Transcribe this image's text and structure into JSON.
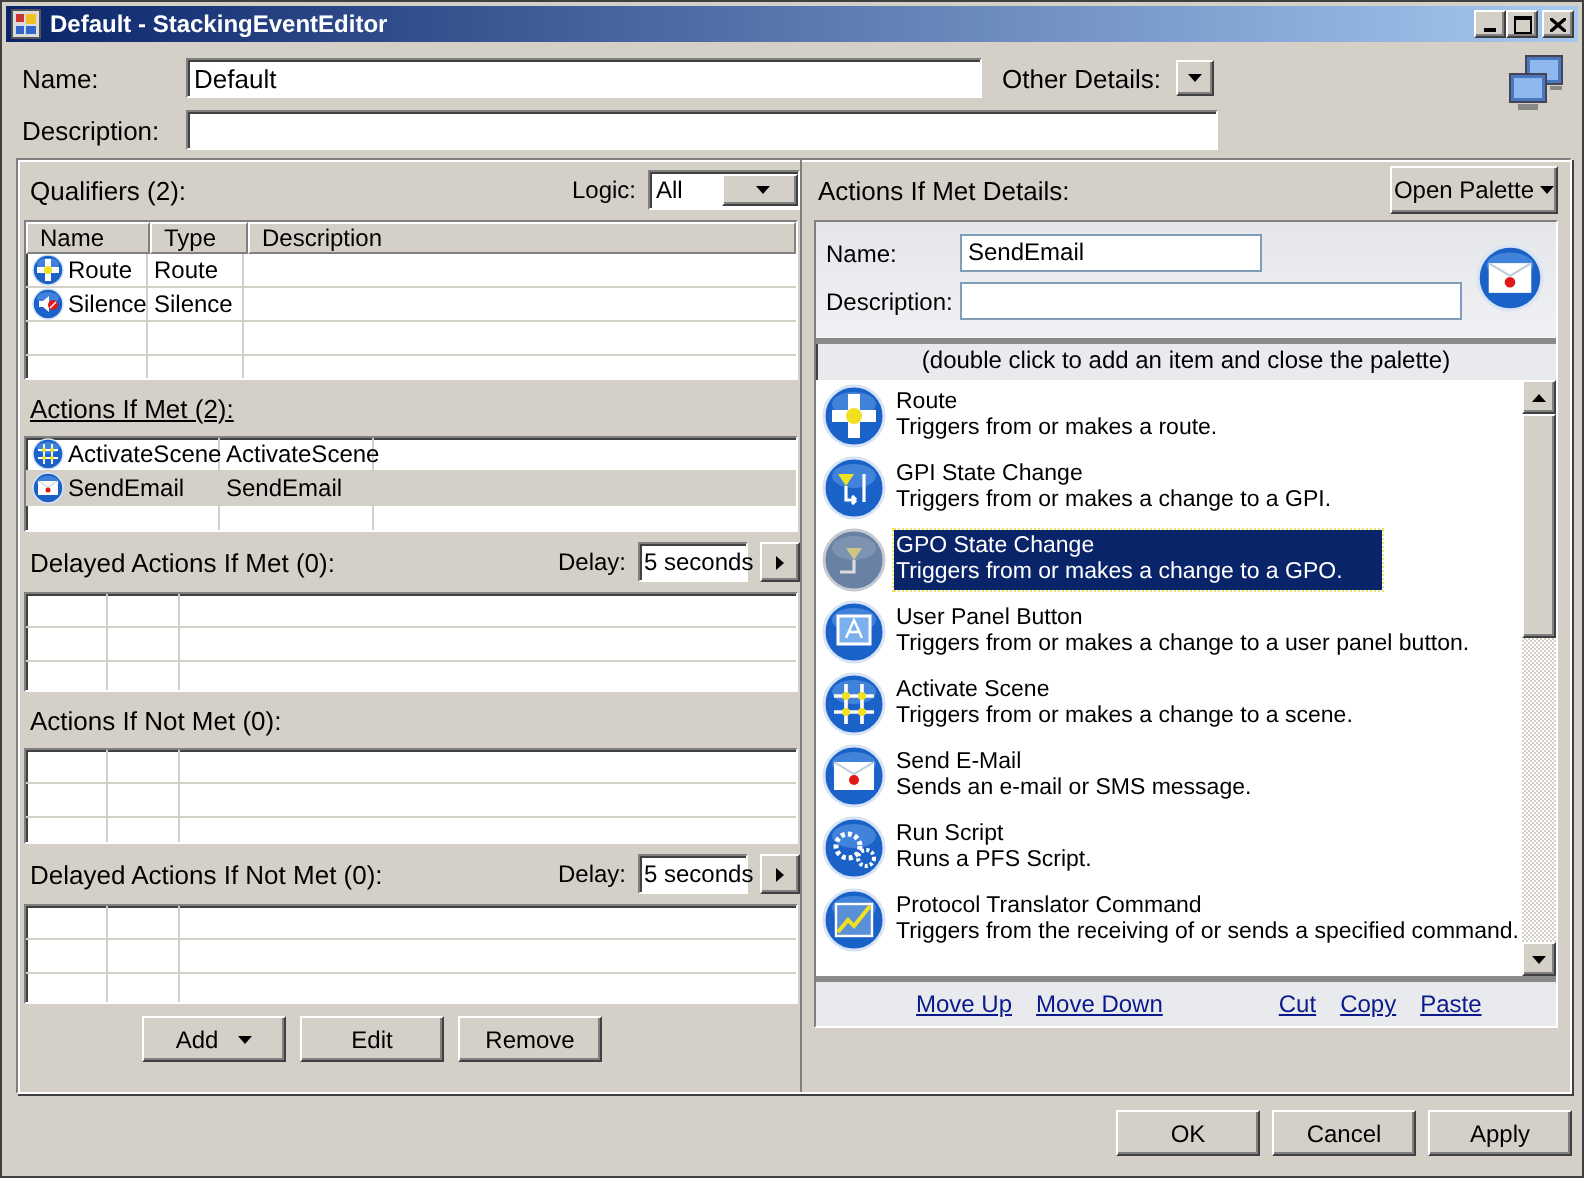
{
  "window": {
    "title": "Default - StackingEventEditor"
  },
  "header": {
    "name_label": "Name:",
    "name_value": "Default",
    "other_label": "Other Details:",
    "description_label": "Description:"
  },
  "sections": [
    {
      "kind": "qualifiers",
      "title": "Qualifiers (2):",
      "active": false,
      "logic_label": "Logic:",
      "logic_value": "All",
      "columns": [
        "Name",
        "Type",
        "Description"
      ],
      "rows": [
        {
          "kind": "route",
          "name": "Route",
          "type": "Route",
          "selected": false
        },
        {
          "kind": "silence",
          "name": "Silence",
          "type": "Silence",
          "selected": false
        }
      ]
    },
    {
      "kind": "actions",
      "title": "Actions If Met (2):",
      "active": true,
      "rows": [
        {
          "kind": "scene",
          "name": "ActivateScene",
          "type": "ActivateScene",
          "selected": false
        },
        {
          "kind": "email",
          "name": "SendEmail",
          "type": "SendEmail",
          "selected": true
        }
      ]
    },
    {
      "kind": "delayed",
      "title": "Delayed Actions If Met (0):",
      "active": false,
      "delay_label": "Delay:",
      "delay_value": "5 seconds"
    },
    {
      "kind": "plain",
      "title": "Actions If Not Met (0):",
      "active": false
    },
    {
      "kind": "delayed",
      "title": "Delayed Actions If Not Met (0):",
      "active": false,
      "delay_label": "Delay:",
      "delay_value": "5 seconds"
    }
  ],
  "list_buttons": [
    {
      "label": "Add",
      "dropdown": true
    },
    {
      "label": "Edit",
      "dropdown": false
    },
    {
      "label": "Remove",
      "dropdown": false
    }
  ],
  "details": {
    "title": "Actions If Met Details:",
    "open_palette": "Open Palette",
    "name_label": "Name:",
    "name_value": "SendEmail",
    "description_label": "Description:",
    "kind": "email",
    "hint": "(double click to add an item and close the palette)",
    "items": [
      {
        "kind": "route",
        "title": "Route",
        "description": "Triggers from or makes a route.",
        "selected": false
      },
      {
        "kind": "gpi",
        "title": "GPI State Change",
        "description": "Triggers from or makes a change to a GPI.",
        "selected": false
      },
      {
        "kind": "gpo",
        "title": "GPO State Change",
        "description": "Triggers from or makes a change to a GPO.",
        "selected": true
      },
      {
        "kind": "panel",
        "title": "User Panel Button",
        "description": "Triggers from or makes a change to a user panel button.",
        "selected": false
      },
      {
        "kind": "scene",
        "title": "Activate Scene",
        "description": "Triggers from or makes a change to a scene.",
        "selected": false
      },
      {
        "kind": "email",
        "title": "Send E-Mail",
        "description": "Sends an e-mail or SMS message.",
        "selected": false
      },
      {
        "kind": "script",
        "title": "Run Script",
        "description": "Runs a PFS Script.",
        "selected": false
      },
      {
        "kind": "protocol",
        "title": "Protocol Translator Command",
        "description": "Triggers from the receiving of or sends a specified command.",
        "selected": false
      }
    ],
    "links_left": [
      "Move Up",
      "Move Down"
    ],
    "links_right": [
      "Cut",
      "Copy",
      "Paste"
    ]
  },
  "buttons": [
    "OK",
    "Cancel",
    "Apply"
  ]
}
